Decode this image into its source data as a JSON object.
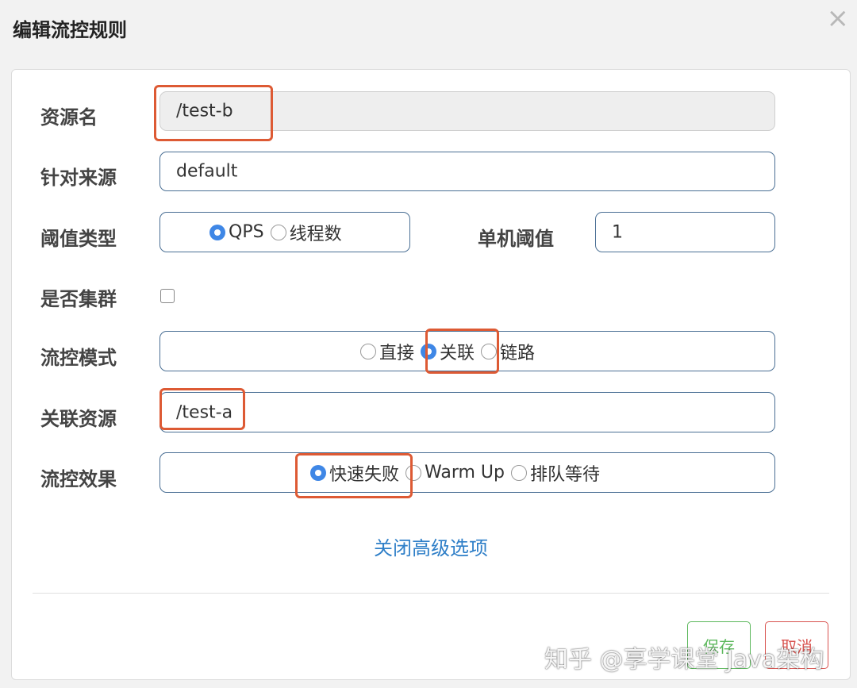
{
  "dialog": {
    "title": "编辑流控规则",
    "close_symbol": "×"
  },
  "form": {
    "resource": {
      "label": "资源名",
      "value": "/test-b"
    },
    "source": {
      "label": "针对来源",
      "value": "default"
    },
    "threshold_type": {
      "label": "阈值类型",
      "options": [
        "QPS",
        "线程数"
      ],
      "selected": "QPS"
    },
    "single_threshold": {
      "label": "单机阈值",
      "value": "1"
    },
    "cluster": {
      "label": "是否集群",
      "checked": false
    },
    "mode": {
      "label": "流控模式",
      "options": [
        "直接",
        "关联",
        "链路"
      ],
      "selected": "关联"
    },
    "related_resource": {
      "label": "关联资源",
      "value": "/test-a"
    },
    "effect": {
      "label": "流控效果",
      "options": [
        "快速失败",
        "Warm Up",
        "排队等待"
      ],
      "selected": "快速失败"
    }
  },
  "advanced_link": "关闭高级选项",
  "buttons": {
    "save": "保存",
    "cancel": "取消"
  },
  "watermark": "知乎 @享学课堂 Java架构",
  "colors": {
    "primary": "#3f87e6",
    "link": "#2f7fc8",
    "highlight": "#dd5a34",
    "save": "#5cb85c",
    "cancel": "#d9534f"
  }
}
